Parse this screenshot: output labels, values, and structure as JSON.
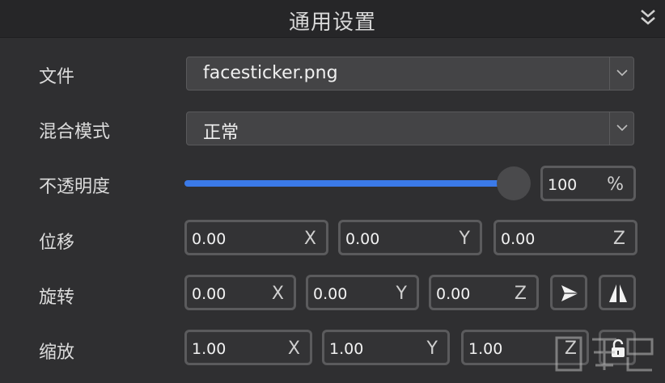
{
  "header": {
    "title": "通用设置",
    "collapse_icon": "double-chevron-down-icon"
  },
  "rows": {
    "file": {
      "label": "文件",
      "value": "facesticker.png"
    },
    "blend": {
      "label": "混合模式",
      "value": "正常"
    },
    "opacity": {
      "label": "不透明度",
      "value": "100",
      "unit": "%",
      "level": 1.0
    },
    "position": {
      "label": "位移",
      "x": "0.00",
      "y": "0.00",
      "z": "0.00",
      "x_unit": "X",
      "y_unit": "Y",
      "z_unit": "Z"
    },
    "rotation": {
      "label": "旋转",
      "x": "0.00",
      "y": "0.00",
      "z": "0.00",
      "x_unit": "X",
      "y_unit": "Y",
      "z_unit": "Z",
      "buttons": [
        "paper-plane-icon",
        "flip-horizontal-icon"
      ]
    },
    "scale": {
      "label": "缩放",
      "x": "1.00",
      "y": "1.00",
      "z": "1.00",
      "x_unit": "X",
      "y_unit": "Y",
      "z_unit": "Z",
      "lock_icon": "unlocked-padlock-icon"
    }
  },
  "colors": {
    "accent": "#3b7ae8",
    "background": "#2f2f31"
  }
}
